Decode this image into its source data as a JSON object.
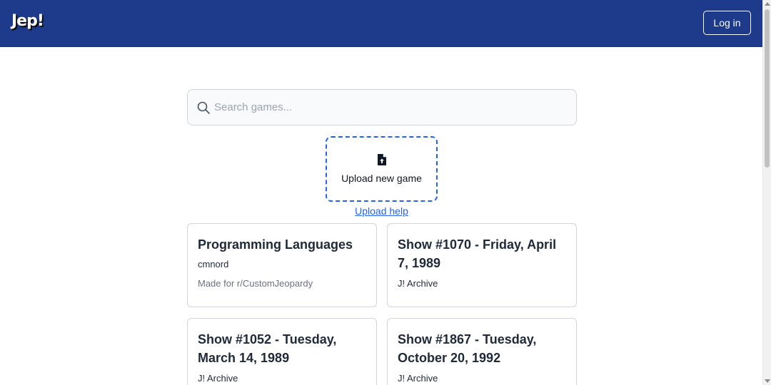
{
  "header": {
    "logo": "Jep!",
    "login_label": "Log in"
  },
  "search": {
    "placeholder": "Search games...",
    "value": "",
    "icon": "search-icon"
  },
  "upload": {
    "label": "Upload new game",
    "icon": "file-upload-icon",
    "help_label": "Upload help"
  },
  "games": [
    {
      "title": "Programming Languages",
      "author": "cmnord",
      "description": "Made for r/CustomJeopardy"
    },
    {
      "title": "Show #1070 - Friday, April 7, 1989",
      "author": "J! Archive",
      "description": ""
    },
    {
      "title": "Show #1052 - Tuesday, March 14, 1989",
      "author": "J! Archive",
      "description": ""
    },
    {
      "title": "Show #1867 - Tuesday, October 20, 1992",
      "author": "J! Archive",
      "description": ""
    }
  ]
}
